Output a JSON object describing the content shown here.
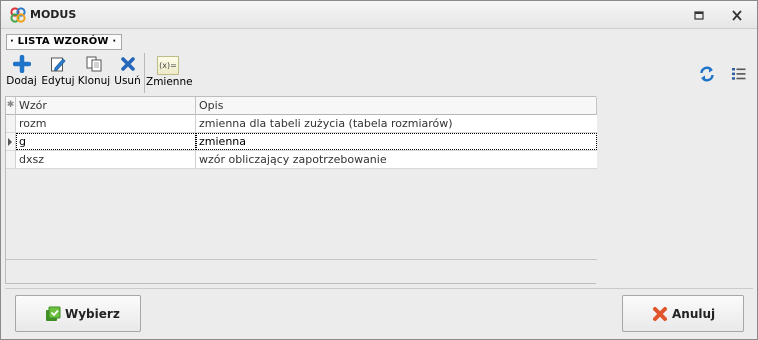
{
  "window": {
    "title": "MODUS"
  },
  "group": {
    "label": "· LISTA WZORÓW ·"
  },
  "toolbar": {
    "add": "Dodaj",
    "edit": "Edytuj",
    "clone": "Klonuj",
    "delete": "Usuń",
    "variables_icon_text": "(x)=",
    "variables": "Zmienne"
  },
  "grid": {
    "columns": {
      "wzor": "Wzór",
      "opis": "Opis"
    },
    "rows": [
      {
        "wzor": "rozm",
        "opis": "zmienna dla tabeli zużycia (tabela rozmiarów)"
      },
      {
        "wzor": "g",
        "opis": "zmienna"
      },
      {
        "wzor": "dxsz",
        "opis": "wzór obliczający zapotrzebowanie"
      }
    ],
    "selected_row_index": 1
  },
  "buttons": {
    "select": "Wybierz",
    "cancel": "Anuluj"
  },
  "colors": {
    "accent_blue": "#1f73c8",
    "ok_green": "#4da32c",
    "cancel_red": "#e0552b"
  }
}
